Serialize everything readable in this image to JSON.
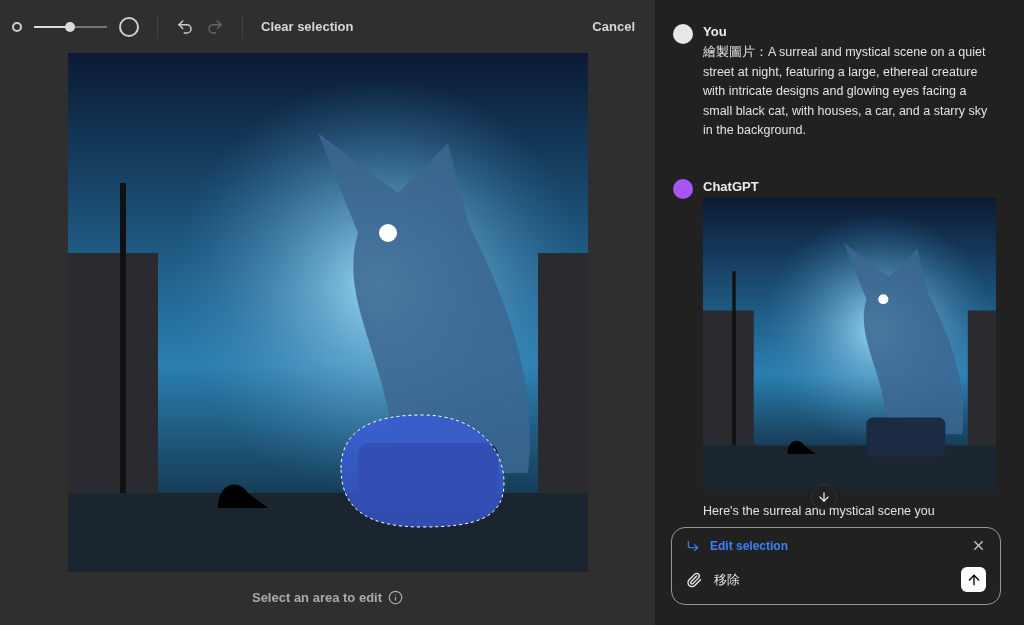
{
  "toolbar": {
    "brush_size": {
      "level": 0.49
    },
    "undo": {
      "disabled": false
    },
    "redo": {
      "disabled": true
    },
    "clear_label": "Clear selection",
    "cancel_label": "Cancel"
  },
  "editor": {
    "hint": "Select an area to edit"
  },
  "chat": {
    "messages": [
      {
        "kind": "user",
        "author": "You",
        "text": "繪製圖片：A surreal and mystical scene on a quiet street at night, featuring a large, ethereal creature with intricate designs and glowing eyes facing a small black cat, with houses, a car, and a starry sky in the background."
      },
      {
        "kind": "assistant",
        "author": "ChatGPT",
        "text": "Here's the surreal and mystical scene you"
      }
    ]
  },
  "composer": {
    "mode_label": "Edit selection",
    "value": "移除"
  }
}
